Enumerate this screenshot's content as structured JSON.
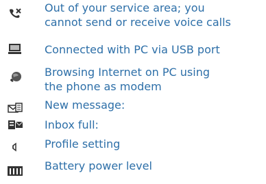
{
  "legend": {
    "items": [
      {
        "icon": "no-service-icon",
        "lines": [
          "Out of your service area; you",
          "cannot send or receive voice calls"
        ]
      },
      {
        "icon": "pc-usb-icon",
        "lines": [
          "Connected with PC via USB port"
        ]
      },
      {
        "icon": "globe-modem-icon",
        "lines": [
          "Browsing Internet on PC using",
          "the phone as modem"
        ]
      },
      {
        "icon": "new-message-icon",
        "lines": [
          "New message:"
        ]
      },
      {
        "icon": "inbox-full-icon",
        "lines": [
          "Inbox full:"
        ]
      },
      {
        "icon": "profile-setting-icon",
        "lines": [
          "Profile setting"
        ]
      },
      {
        "icon": "battery-level-icon",
        "lines": [
          "Battery power level"
        ]
      }
    ]
  },
  "colors": {
    "text": "#2d6fa8",
    "icon": "#333333"
  }
}
